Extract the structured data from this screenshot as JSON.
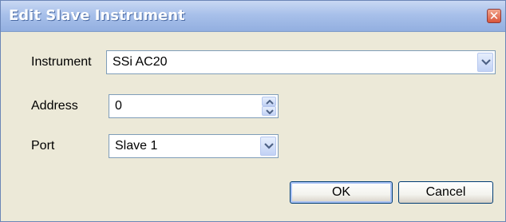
{
  "window": {
    "title": "Edit Slave Instrument",
    "close_glyph": "✕"
  },
  "form": {
    "instrument": {
      "label": "Instrument",
      "value": "SSi AC20"
    },
    "address": {
      "label": "Address",
      "value": "0"
    },
    "port": {
      "label": "Port",
      "value": "Slave 1"
    }
  },
  "buttons": {
    "ok_label": "OK",
    "cancel_label": "Cancel"
  },
  "icons": {
    "close": "close-icon",
    "dropdown": "chevron-down-icon",
    "spin_up": "arrow-up-icon",
    "spin_down": "arrow-down-icon"
  },
  "colors": {
    "titlebar": "#a8c0ea",
    "dialog_bg": "#ece9d8",
    "field_border": "#7f9db9",
    "close_button": "#d9543a",
    "default_button_border": "#003c74"
  }
}
